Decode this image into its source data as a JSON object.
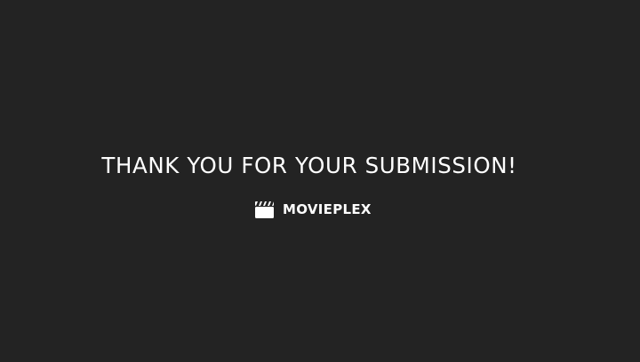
{
  "confirmation": {
    "message": "THANK YOU FOR YOUR SUBMISSION!"
  },
  "brand": {
    "name": "MOVIEPLEX",
    "icon": "clapperboard-icon"
  },
  "colors": {
    "background": "#232323",
    "text": "#ffffff"
  }
}
